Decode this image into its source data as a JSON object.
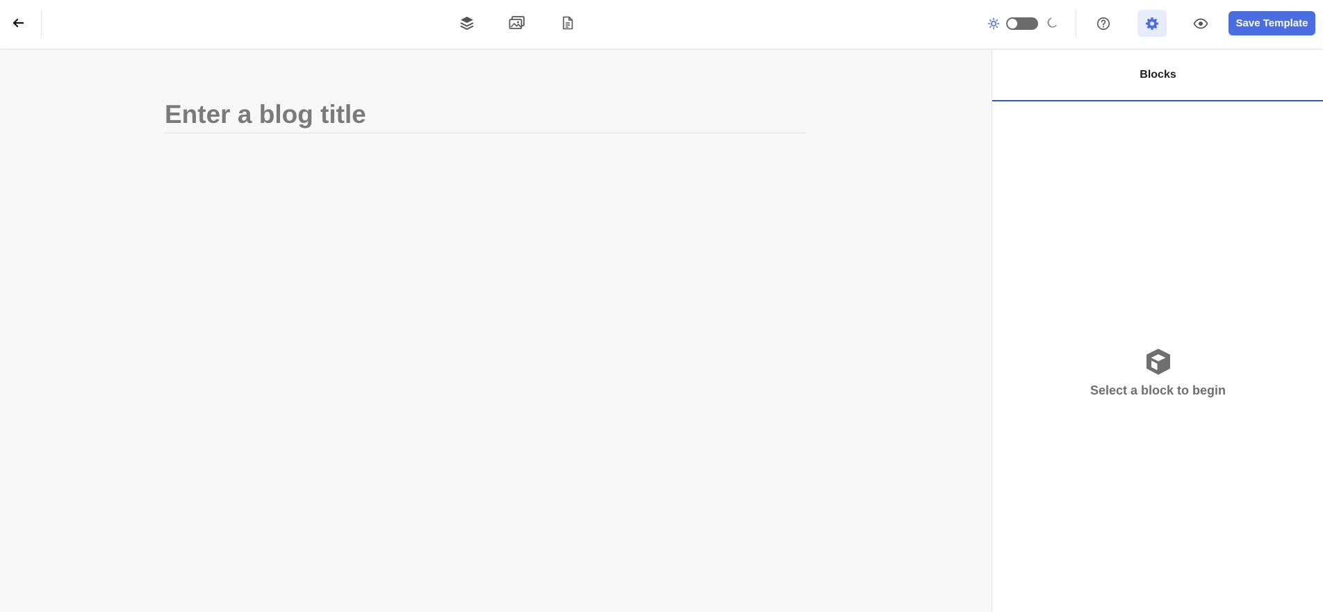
{
  "toolbar": {
    "back_icon": "arrow-left-icon",
    "center_tools": [
      {
        "name": "layers-icon"
      },
      {
        "name": "media-gallery-icon"
      },
      {
        "name": "document-icon"
      }
    ],
    "theme": {
      "sun_icon": "sun-icon",
      "moon_icon": "moon-icon",
      "dark_mode": false
    },
    "help_icon": "help-circle-icon",
    "settings_icon": "gear-icon",
    "preview_icon": "eye-icon",
    "save_label": "Save Template"
  },
  "editor": {
    "title_placeholder": "Enter a blog title",
    "title_value": ""
  },
  "sidebar": {
    "tab_label": "Blocks",
    "empty_icon": "cube-icon",
    "empty_text": "Select a block to begin"
  },
  "colors": {
    "accent": "#4a6ee0",
    "tab_underline": "#2f55d4",
    "active_bg": "#e7ecfb",
    "editor_bg": "#f8f8f8"
  }
}
